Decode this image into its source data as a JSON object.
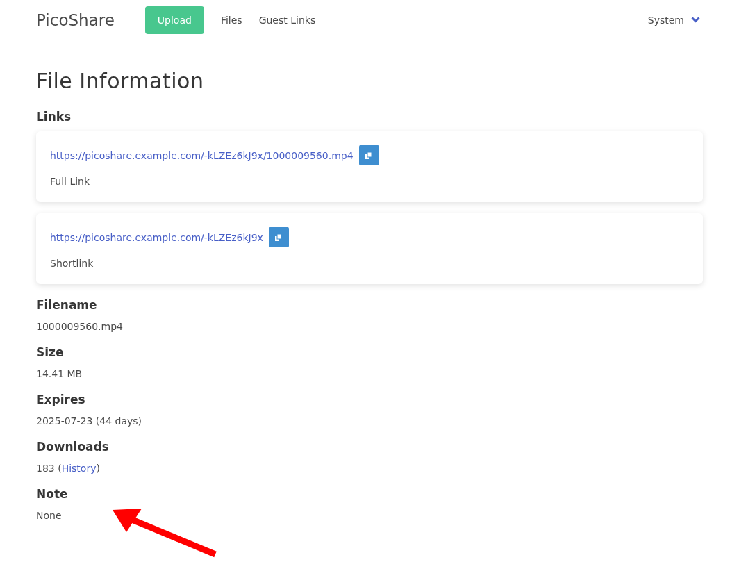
{
  "navbar": {
    "brand": "PicoShare",
    "upload_button": "Upload",
    "links": [
      "Files",
      "Guest Links"
    ],
    "menu": "System"
  },
  "page_title": "File Information",
  "links_section": {
    "heading": "Links",
    "cards": [
      {
        "url": "https://picoshare.example.com/-kLZEz6kJ9x/1000009560.mp4",
        "label": "Full Link"
      },
      {
        "url": "https://picoshare.example.com/-kLZEz6kJ9x",
        "label": "Shortlink"
      }
    ]
  },
  "fields": [
    {
      "kind": "text",
      "label": "Filename",
      "value": "1000009560.mp4"
    },
    {
      "kind": "text",
      "label": "Size",
      "value": "14.41 MB"
    },
    {
      "kind": "text",
      "label": "Expires",
      "value": "2025-07-23 (44 days)"
    },
    {
      "kind": "link",
      "label": "Downloads",
      "value": "183 (",
      "link": "History",
      "suffix": ")"
    },
    {
      "kind": "text",
      "label": "Note",
      "value": "None"
    }
  ]
}
